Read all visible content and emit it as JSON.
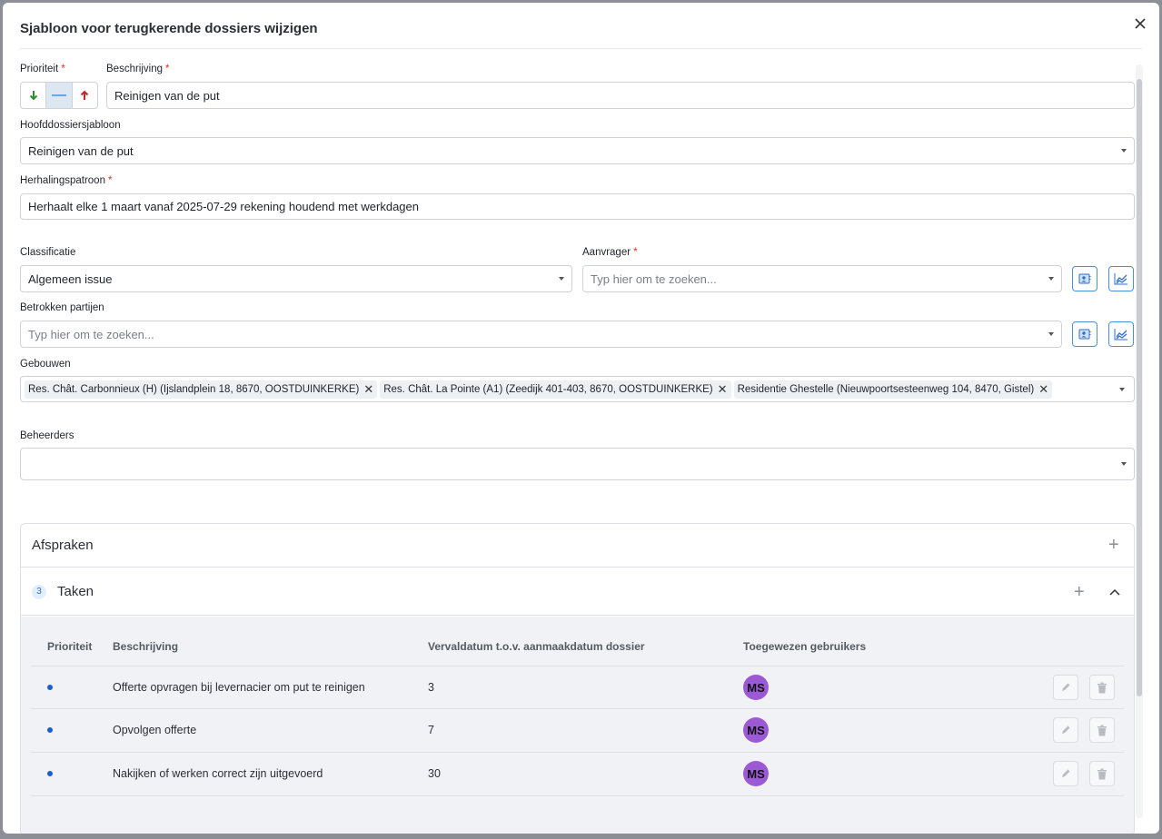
{
  "modal": {
    "title": "Sjabloon voor terugkerende dossiers wijzigen"
  },
  "form": {
    "priority_label": "Prioriteit",
    "required_mark": "*",
    "description_label": "Beschrijving",
    "description_value": "Reinigen van de put",
    "parent_template_label": "Hoofddossiersjabloon",
    "parent_template_value": "Reinigen van de put",
    "recurrence_label": "Herhalingspatroon",
    "recurrence_value": "Herhaalt elke 1 maart vanaf 2025-07-29 rekening houdend met werkdagen",
    "classification_label": "Classificatie",
    "classification_value": "Algemeen issue",
    "requester_label": "Aanvrager",
    "requester_placeholder": "Typ hier om te zoeken...",
    "parties_label": "Betrokken partijen",
    "parties_placeholder": "Typ hier om te zoeken...",
    "buildings_label": "Gebouwen",
    "buildings": [
      "Res. Chât. Carbonnieux (H) (Ijslandplein 18, 8670, OOSTDUINKERKE)",
      "Res. Chât. La Pointe (A1) (Zeedijk 401-403, 8670, OOSTDUINKERKE)",
      "Residentie Ghestelle (Nieuwpoortsesteenweg 104, 8470, Gistel)"
    ],
    "managers_label": "Beheerders"
  },
  "appointments": {
    "title": "Afspraken"
  },
  "tasks": {
    "title": "Taken",
    "count": "3",
    "headers": {
      "priority": "Prioriteit",
      "description": "Beschrijving",
      "due": "Vervaldatum t.o.v. aanmaakdatum dossier",
      "assigned": "Toegewezen gebruikers"
    },
    "rows": [
      {
        "description": "Offerte opvragen bij levernacier om put te reinigen",
        "due": "3",
        "avatar": "MS"
      },
      {
        "description": "Opvolgen offerte",
        "due": "7",
        "avatar": "MS"
      },
      {
        "description": "Nakijken of werken correct zijn uitgevoerd",
        "due": "30",
        "avatar": "MS"
      }
    ]
  },
  "colors": {
    "accent": "#4a90d9",
    "avatar": "#9b59d6",
    "priority_dot": "#1a5fc9"
  }
}
